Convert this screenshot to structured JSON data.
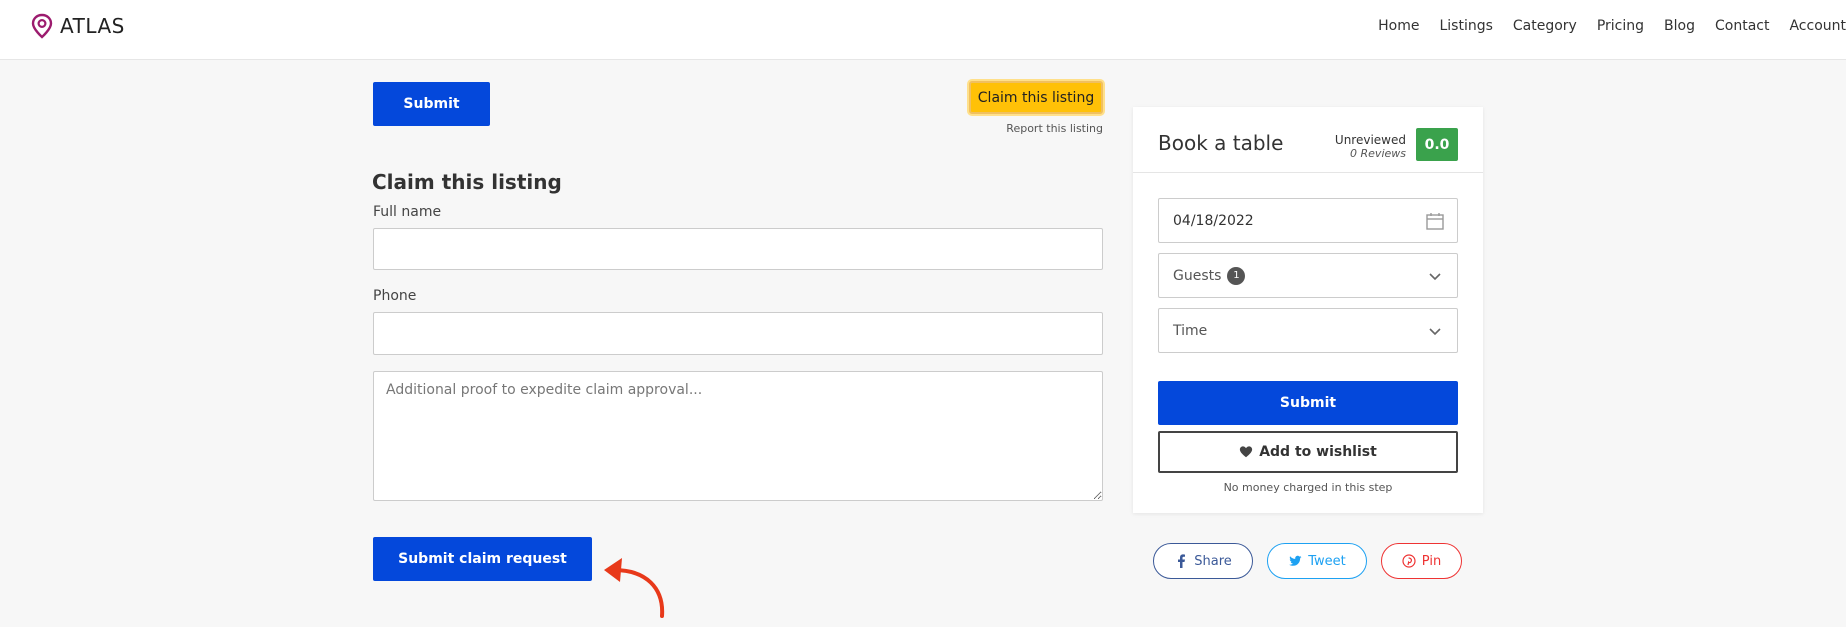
{
  "brand": {
    "name": "ATLAS",
    "accent": "#9c1b6e"
  },
  "nav": {
    "home": "Home",
    "listings": "Listings",
    "category": "Category",
    "pricing": "Pricing",
    "blog": "Blog",
    "contact": "Contact",
    "account": "Account"
  },
  "claim": {
    "submit_label": "Submit",
    "claim_button": "Claim this listing",
    "report_link": "Report this listing",
    "title": "Claim this listing",
    "fullname_label": "Full name",
    "fullname_value": "",
    "phone_label": "Phone",
    "phone_value": "",
    "proof_placeholder": "Additional proof to expedite claim approval...",
    "submit_claim_label": "Submit claim request"
  },
  "booking": {
    "title": "Book a table",
    "review_status": "Unreviewed",
    "review_count": "0 Reviews",
    "score": "0.0",
    "date": "04/18/2022",
    "guests_label": "Guests",
    "guests_count": "1",
    "time_label": "Time",
    "submit_label": "Submit",
    "wishlist_label": "Add to wishlist",
    "note": "No money charged in this step"
  },
  "share": {
    "facebook": "Share",
    "twitter": "Tweet",
    "pinterest": "Pin"
  },
  "colors": {
    "primary": "#0448db",
    "claim": "#ffc107",
    "score": "#3aa24c",
    "arrow": "#e8391a"
  }
}
